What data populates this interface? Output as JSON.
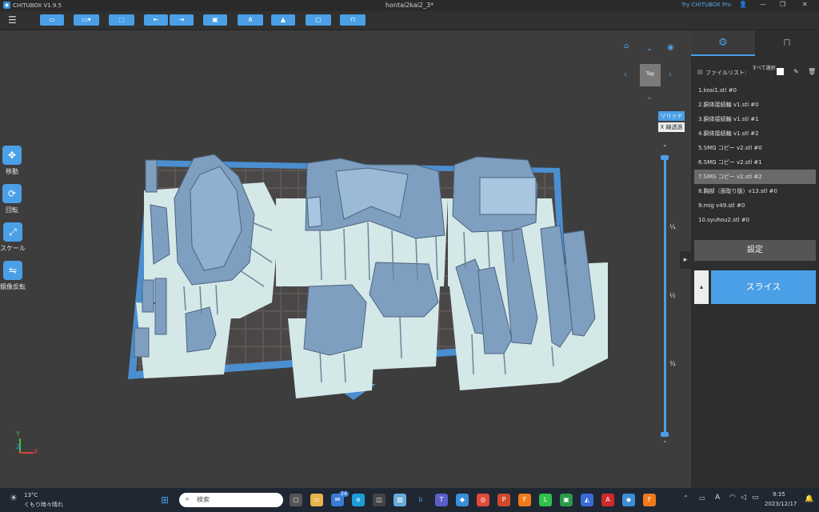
{
  "titlebar": {
    "app_name": "CHITUBOX V1.9.5",
    "document_title": "hontai2kai2_3*",
    "try_pro": "Try CHITUBOX Pro",
    "window_controls": {
      "minimize": "—",
      "maximize": "❐",
      "close": "✕"
    }
  },
  "toolbar": {
    "menu_icon": "☰",
    "buttons": [
      {
        "icon": "folder-open-icon",
        "glyph": "▭"
      },
      {
        "icon": "save-icon",
        "glyph": "▭▾"
      },
      {
        "icon": "select-icon",
        "glyph": "⬚"
      },
      {
        "icon": "import-icon",
        "glyph": "⇤"
      },
      {
        "icon": "export-icon",
        "glyph": "⇥"
      },
      {
        "icon": "layout-icon",
        "glyph": "▣"
      },
      {
        "icon": "support-icon",
        "glyph": "⋔"
      },
      {
        "icon": "hollow-icon",
        "glyph": "▲"
      },
      {
        "icon": "frame-icon",
        "glyph": "▢"
      },
      {
        "icon": "lock-icon",
        "glyph": "⊓"
      }
    ]
  },
  "left_tools": [
    {
      "label": "移動",
      "glyph": "✥"
    },
    {
      "label": "回転",
      "glyph": "⟳"
    },
    {
      "label": "スケール",
      "glyph": "⤢"
    },
    {
      "label": "鏡像反転",
      "glyph": "⇋"
    }
  ],
  "view_cube": {
    "face_label": "Top"
  },
  "render_mode": {
    "solid": "ソリッド",
    "xray": "X 線透過"
  },
  "layer_slider": {
    "marks": [
      "¼",
      "½",
      "¾"
    ]
  },
  "axes": {
    "y": "Y",
    "z": "Z",
    "x": "X"
  },
  "sidebar": {
    "file_list_label": "ファイルリスト:",
    "select_all_label": "すべて選択",
    "files": [
      {
        "name": "1.kosi1.stl #0",
        "selected": false
      },
      {
        "name": "2.胴体接続軸 v1.stl #0",
        "selected": false
      },
      {
        "name": "3.胴体接続軸 v1.stl #1",
        "selected": false
      },
      {
        "name": "4.胴体接続軸 v1.stl #2",
        "selected": false
      },
      {
        "name": "5.SMG コピー v2.stl #0",
        "selected": false
      },
      {
        "name": "6.SMG コピー v2.stl #1",
        "selected": false
      },
      {
        "name": "7.SMG コピー v2.stl #2",
        "selected": true
      },
      {
        "name": "8.胸部（面取り版）v13.stl #0",
        "selected": false
      },
      {
        "name": "9.mig v49.stl #0",
        "selected": false
      },
      {
        "name": "10.syuhou2.stl #0",
        "selected": false
      }
    ],
    "settings_label": "設定",
    "slice_label": "スライス"
  },
  "taskbar": {
    "temperature": "13°C",
    "weather": "くもり時々晴れ",
    "search_placeholder": "検索",
    "time": "9:35",
    "date": "2023/12/17",
    "badge": "24",
    "ime": "A"
  },
  "colors": {
    "accent": "#4a9fe6",
    "model": "#7f9fc0",
    "plate": "#5d5555",
    "support_base": "#d4e8e8"
  }
}
